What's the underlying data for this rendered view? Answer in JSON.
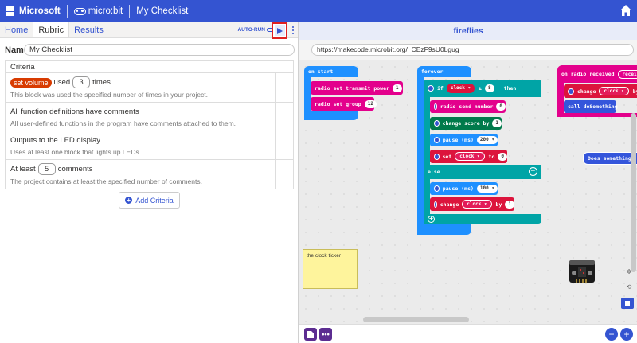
{
  "header": {
    "microsoft_label": "Microsoft",
    "microbit_label": "micro:bit",
    "title": "My Checklist"
  },
  "tabs": [
    {
      "label": "Home"
    },
    {
      "label": "Rubric"
    },
    {
      "label": "Results"
    }
  ],
  "toolbar": {
    "autorun_label": "AUTO-RUN"
  },
  "name_field": {
    "label": "Name",
    "value": "My Checklist"
  },
  "criteria": {
    "header": "Criteria",
    "items": [
      {
        "block": "set volume",
        "text_before": "used",
        "count": "3",
        "text_after": "times",
        "description": "This block was used the specified number of times in your project."
      },
      {
        "title": "All function definitions have comments",
        "description": "All user-defined functions in the program have comments attached to them."
      },
      {
        "title": "Outputs to the LED display",
        "description": "Uses at least one block that lights up LEDs"
      },
      {
        "text_before": "At least",
        "count": "5",
        "text_after": "comments",
        "description": "The project contains at least the specified number of comments."
      }
    ],
    "add_label": "Add Criteria"
  },
  "project": {
    "title": "fireflies",
    "url": "https://makecode.microbit.org/_CEzF9sU0Lgug"
  },
  "blocks": {
    "on_start": "on start",
    "radio_set_power": "radio set transmit power",
    "radio_set_power_val": "1",
    "radio_set_group": "radio set group",
    "radio_set_group_val": "12",
    "forever": "forever",
    "if": "if",
    "clock_var": "clock",
    "ge_op": "≥",
    "if_val": "8",
    "then": "then",
    "send_number": "radio send number",
    "send_number_val": "0",
    "change_score": "change score by",
    "change_score_val": "1",
    "pause1": "pause (ms)",
    "pause1_val": "200",
    "set_clock": "set",
    "set_clock_to": "to",
    "set_clock_val": "0",
    "else": "else",
    "pause2": "pause (ms)",
    "pause2_val": "100",
    "change_clock": "change",
    "change_clock_by": "by",
    "change_clock_val": "1",
    "on_radio": "on radio received",
    "on_radio_param": "receive",
    "change_clock2": "change",
    "change_clock2_by": "by",
    "call_do": "call doSomething",
    "does_something": "Does something"
  },
  "note": "the clock ticker",
  "colors": {
    "header": "#3454d1",
    "radio": "#e3008c",
    "loops": "#1e90ff",
    "logic": "#00a4a6",
    "variables": "#dc143c",
    "game": "#007a4b",
    "music": "#e63022",
    "functions": "#3455db",
    "highlight_box": "#e02020"
  }
}
